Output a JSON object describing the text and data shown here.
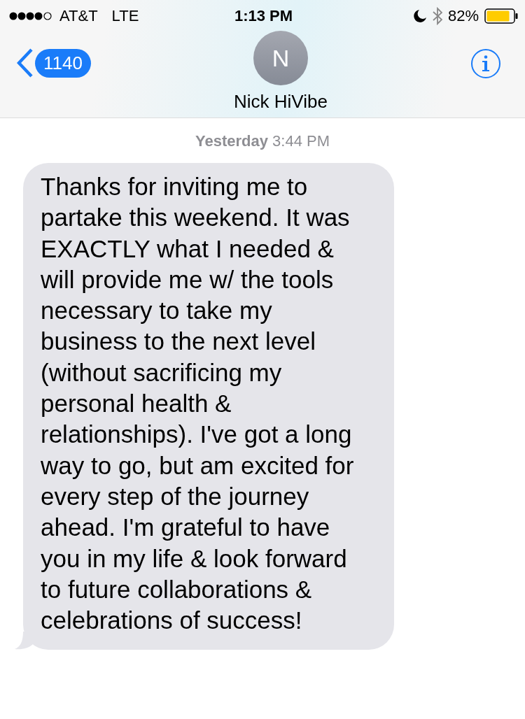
{
  "status_bar": {
    "carrier": "AT&T",
    "network": "LTE",
    "time": "1:13 PM",
    "battery": "82%"
  },
  "header": {
    "back_count": "1140",
    "avatar_initial": "N",
    "contact_name": "Nick HiVibe"
  },
  "messages": [
    {
      "timestamp": "**Yesterday** 3:44 PM",
      "text": "Thanks for inviting me to partake this weekend. It was EXACTLY what I needed & will provide me w/ the tools necessary to take my business to the next level (without sacrificing my personal health & relationships). I've got a long way to go, but am excited for every step of the journey ahead. I'm grateful to have you in my life & look forward to future collaborations & celebrations of success!",
      "kind": "incoming"
    }
  ]
}
